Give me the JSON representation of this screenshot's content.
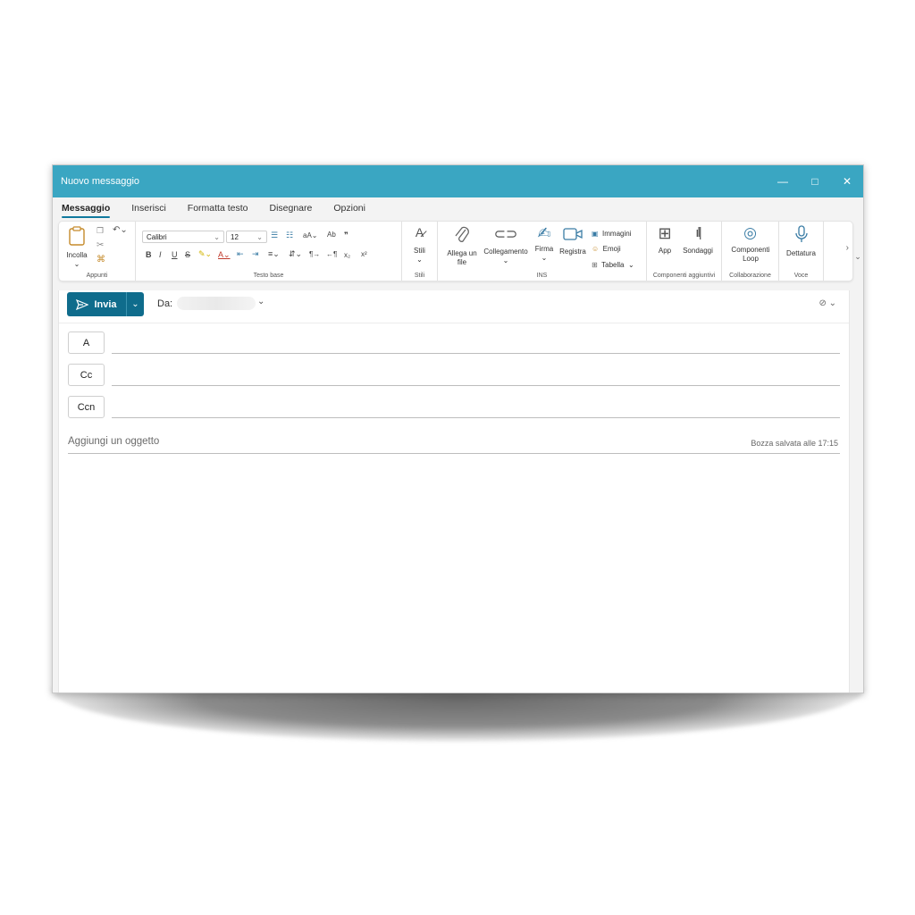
{
  "window": {
    "title": "Nuovo messaggio",
    "minimize": "—",
    "maximize": "□",
    "close": "✕"
  },
  "tabs": [
    {
      "label": "Messaggio",
      "active": true
    },
    {
      "label": "Inserisci"
    },
    {
      "label": "Formatta testo"
    },
    {
      "label": "Disegnare"
    },
    {
      "label": "Opzioni"
    }
  ],
  "ribbon": {
    "appunti": {
      "paste": "Incolla",
      "group": "Appunti"
    },
    "testo": {
      "font": "Calibri",
      "size": "12",
      "group": "Testo base"
    },
    "stili": {
      "label": "Stili",
      "group": "Stili"
    },
    "ins": {
      "attach": "Allega un file",
      "link": "Collegamento",
      "signature": "Firma",
      "record": "Registra",
      "images": "Immagini",
      "emoji": "Emoji",
      "table": "Tabella",
      "group": "INS"
    },
    "addins": {
      "apps": "App",
      "polls": "Sondaggi",
      "group": "Componenti aggiuntivi"
    },
    "collab": {
      "loop": "Componenti Loop",
      "group": "Collaborazione"
    },
    "voice": {
      "dictate": "Dettatura",
      "group": "Voce"
    }
  },
  "compose": {
    "send_label": "Invia",
    "from_label": "Da:",
    "to_label": "A",
    "cc_label": "Cc",
    "bcc_label": "Ccn",
    "subject_placeholder": "Aggiungi un oggetto",
    "draft_status": "Bozza salvata alle 17:15"
  },
  "colors": {
    "titlebar": "#3aa6c2",
    "accent": "#0f6c8c"
  }
}
